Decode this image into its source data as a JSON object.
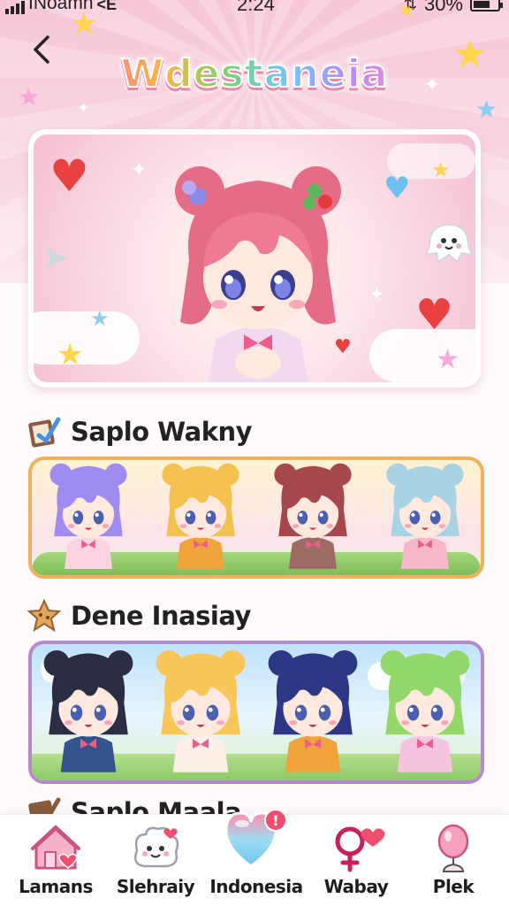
{
  "status_bar": {
    "carrier": "INoamn",
    "network": "<E",
    "time": "2:24",
    "battery": "30%"
  },
  "header": {
    "title": "Wdestaneia"
  },
  "sections": [
    {
      "title": "Saplo Wakny",
      "characters": [
        {
          "hair": "#9f8cf0",
          "outfit": "#fdd3e2"
        },
        {
          "hair": "#f6c24f",
          "outfit": "#f0a33a"
        },
        {
          "hair": "#a5474c",
          "outfit": "#9c6b63"
        },
        {
          "hair": "#a9d2e2",
          "outfit": "#f6b7c8"
        }
      ]
    },
    {
      "title": "Dene Inasiay",
      "characters": [
        {
          "hair": "#2b2d45",
          "outfit": "#34558c"
        },
        {
          "hair": "#f8c659",
          "outfit": "#fdf0e8"
        },
        {
          "hair": "#2e3783",
          "outfit": "#f0a33a"
        },
        {
          "hair": "#93d86a",
          "outfit": "#f6c4df"
        }
      ]
    },
    {
      "title": "Saplo Maala"
    }
  ],
  "bottom_nav": [
    {
      "label": "Lamans",
      "icon": "house-heart-icon"
    },
    {
      "label": "Slehraiy",
      "icon": "mascot-icon"
    },
    {
      "label": "Indonesia",
      "icon": "heart-bubble-icon",
      "badge": "!"
    },
    {
      "label": "Wabay",
      "icon": "female-heart-icon"
    },
    {
      "label": "Plek",
      "icon": "balloon-icon"
    }
  ],
  "colors": {
    "accent_pink": "#f7a8c4",
    "accent_orange": "#f2b15d",
    "accent_purple": "#b789c9"
  }
}
